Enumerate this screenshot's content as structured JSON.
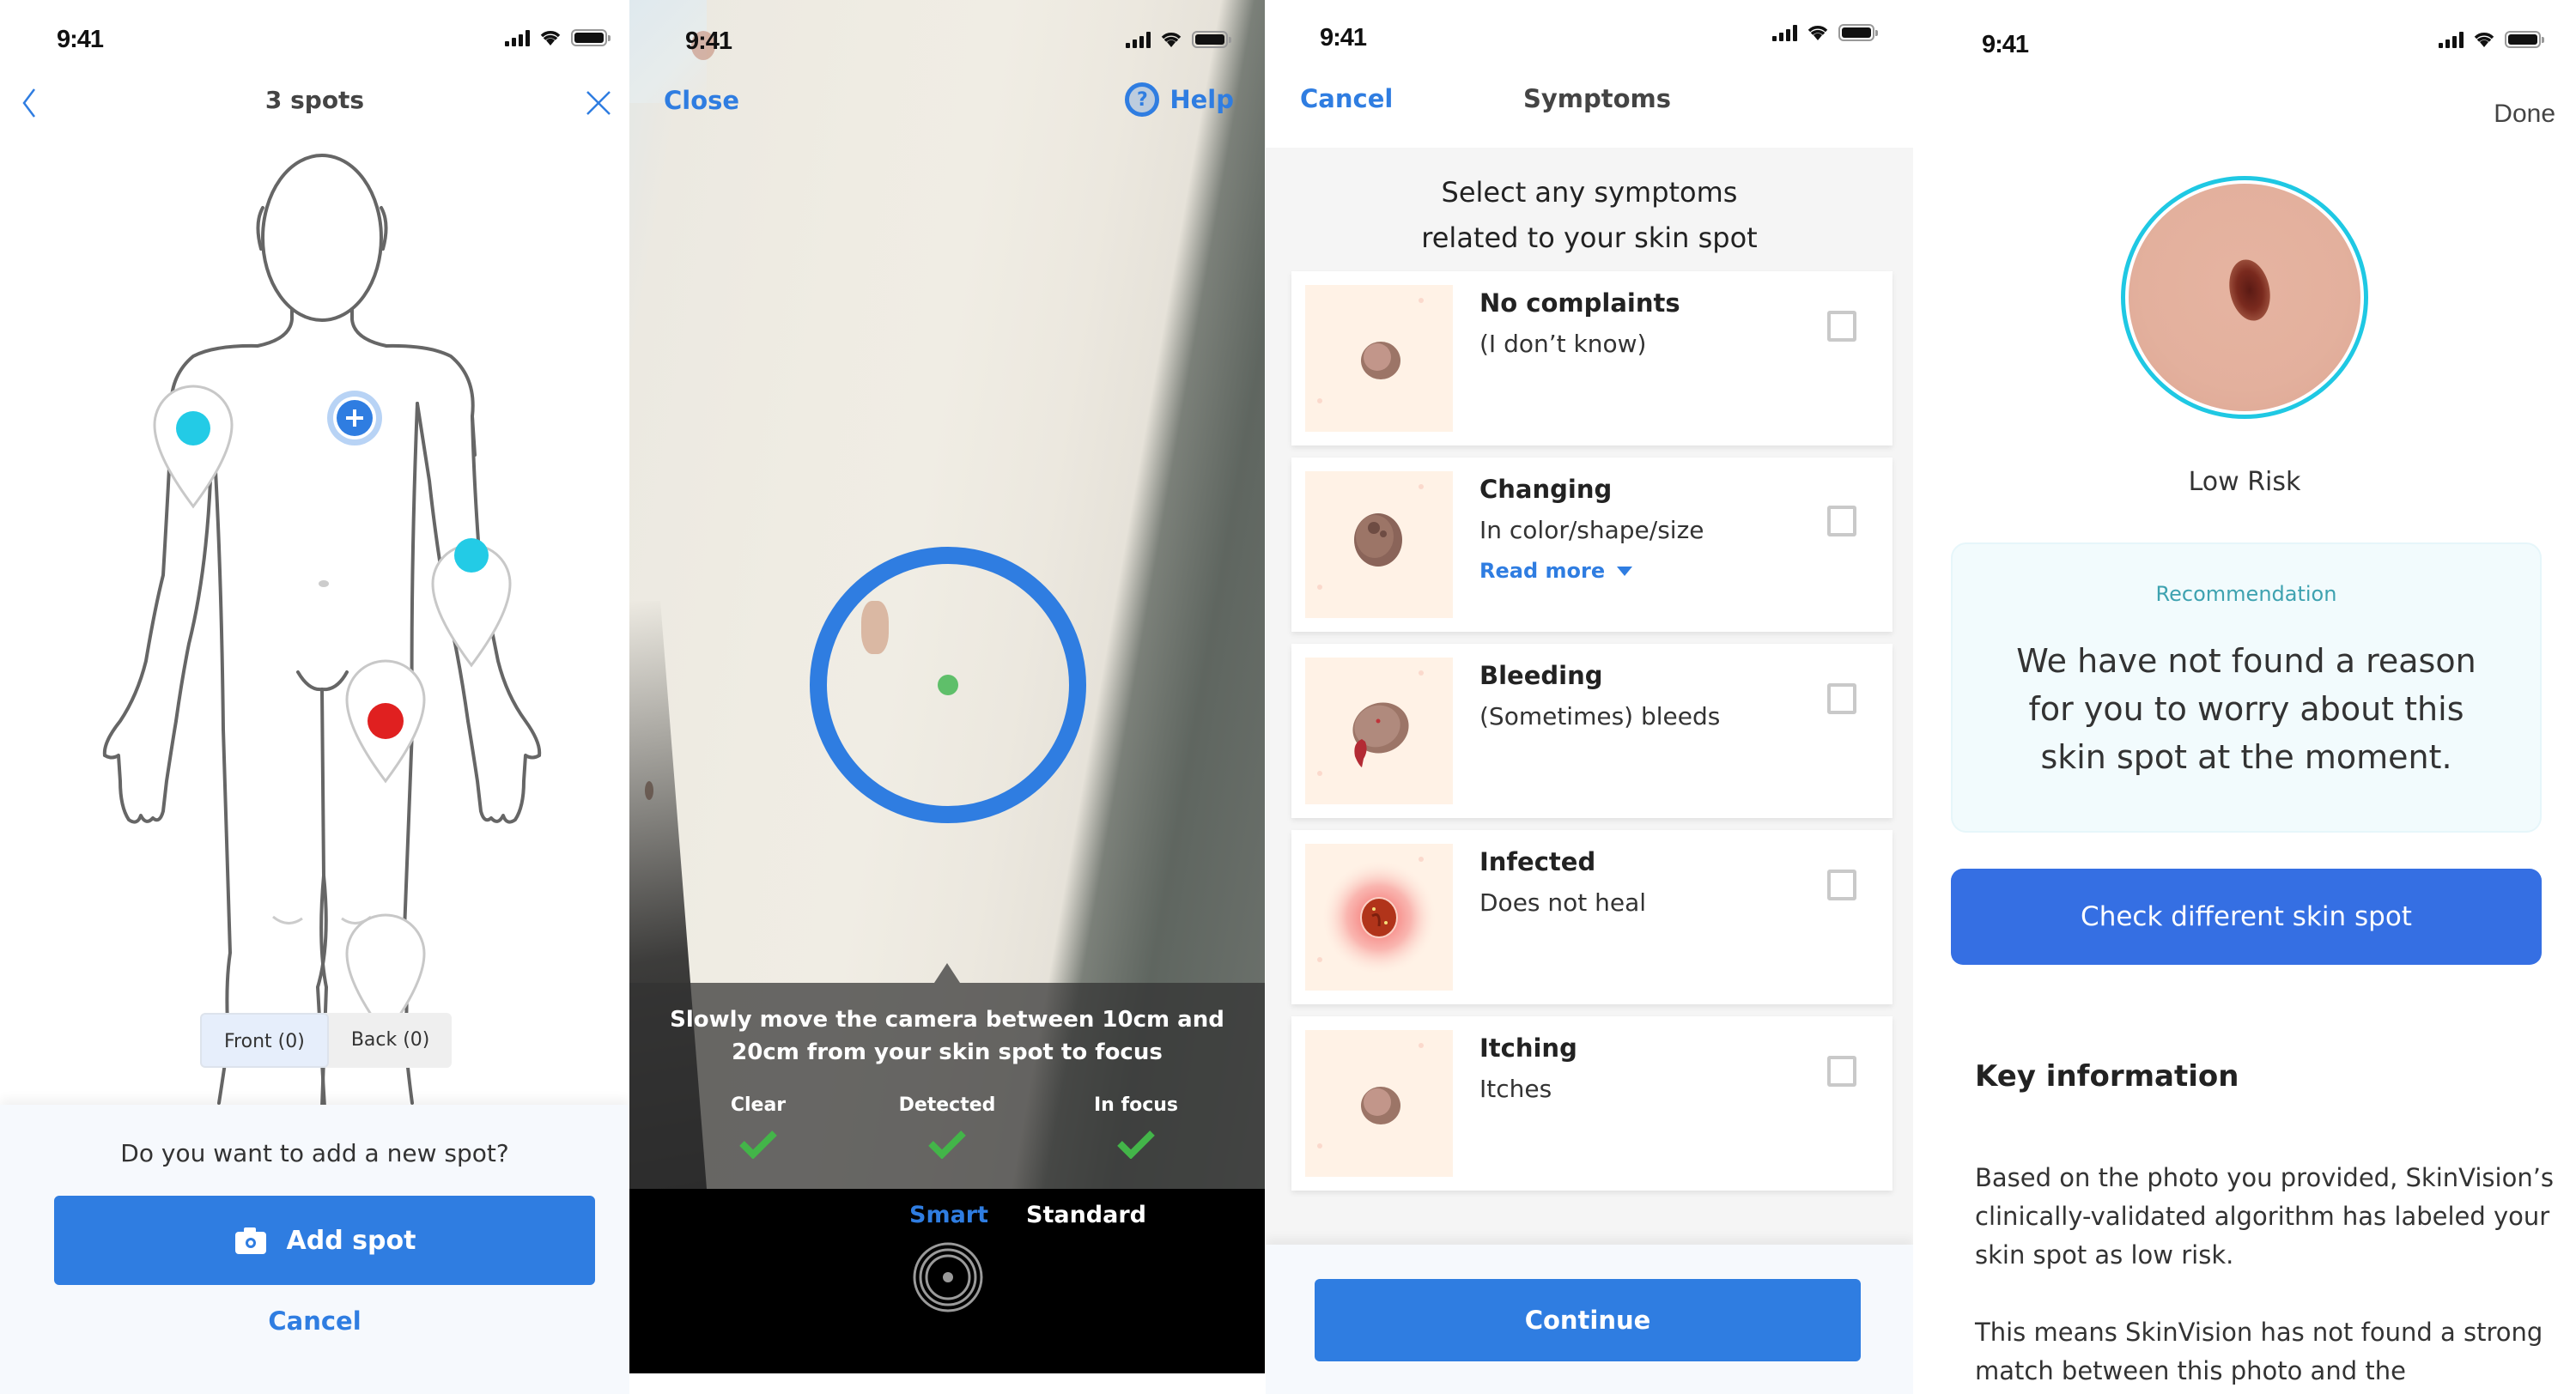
{
  "status_bar": {
    "time": "9:41"
  },
  "screen_body_map": {
    "title": "3 spots",
    "back_icon": "chevron-left-icon",
    "close_icon": "close-icon",
    "spot_pins": [
      {
        "location": "right-upper-arm",
        "color": "#23cbe6"
      },
      {
        "location": "left-forearm",
        "color": "#23cbe6"
      },
      {
        "location": "left-thigh",
        "color": "#e02020"
      }
    ],
    "add_marker_icon": "plus-circle-icon",
    "view_toggle": [
      {
        "label": "Front (0)",
        "selected": true
      },
      {
        "label": "Back (0)",
        "selected": false
      }
    ],
    "sheet": {
      "question": "Do you want to add a new spot?",
      "add_button_label": "Add spot",
      "add_button_icon": "camera-icon",
      "cancel_label": "Cancel"
    }
  },
  "screen_camera": {
    "close_label": "Close",
    "help_label": "Help",
    "help_icon": "question-circle-icon",
    "hint": "Slowly move the camera between 10cm and 20cm from your skin spot to focus",
    "checks": [
      {
        "label": "Clear",
        "ok": true
      },
      {
        "label": "Detected",
        "ok": true
      },
      {
        "label": "In focus",
        "ok": true
      }
    ],
    "modes": [
      {
        "label": "Smart",
        "active": true
      },
      {
        "label": "Standard",
        "active": false
      }
    ],
    "shutter_icon": "shutter-icon"
  },
  "screen_symptoms": {
    "cancel_label": "Cancel",
    "title": "Symptoms",
    "intro": "Select any symptoms related to your skin spot",
    "items": [
      {
        "title": "No complaints",
        "subtitle": "(I don’t know)",
        "checked": false,
        "illustration": "mole-normal"
      },
      {
        "title": "Changing",
        "subtitle": "In color/shape/size",
        "link": "Read more",
        "checked": false,
        "illustration": "mole-changing"
      },
      {
        "title": "Bleeding",
        "subtitle": "(Sometimes) bleeds",
        "checked": false,
        "illustration": "mole-bleeding"
      },
      {
        "title": "Infected",
        "subtitle": "Does not heal",
        "checked": false,
        "illustration": "mole-infected"
      },
      {
        "title": "Itching",
        "subtitle": "Itches",
        "checked": false,
        "illustration": "mole-normal"
      }
    ],
    "continue_label": "Continue"
  },
  "screen_result": {
    "done_label": "Done",
    "risk_label": "Low Risk",
    "risk_color": "#1fc8e3",
    "recommendation_label": "Recommendation",
    "recommendation_text": "We have not found a reason for you to worry about this skin spot at the moment.",
    "check_button_label": "Check different skin spot",
    "key_info_title": "Key information",
    "paragraphs": [
      "Based on the photo you provided, SkinVision’s clinically-validated algorithm has labeled your skin spot as low risk.",
      "This means SkinVision has not found a strong match between this photo and the"
    ]
  },
  "colors": {
    "accent": "#2f7de1",
    "check_green": "#43b549"
  }
}
